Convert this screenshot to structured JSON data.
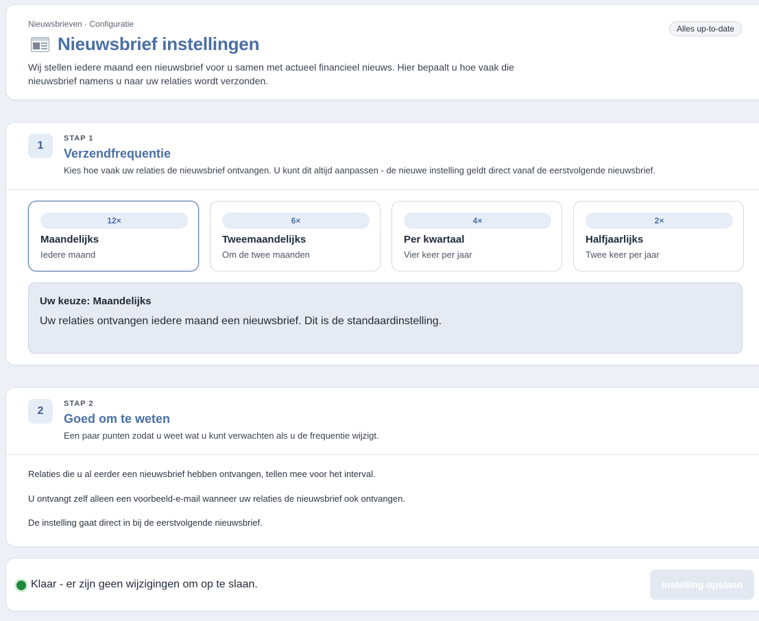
{
  "header": {
    "breadcrumb": "Nieuwsbrieven · Configuratie",
    "status": "Alles up-to-date",
    "icon": "newspaper-icon",
    "title": "Nieuwsbrief instellingen",
    "intro": "Wij stellen iedere maand een nieuwsbrief voor u samen met actueel financieel nieuws. Hier bepaalt u hoe vaak die nieuwsbrief namens u naar uw relaties wordt verzonden."
  },
  "step1": {
    "number": "1",
    "kicker": "STAP 1",
    "title": "Verzendfrequentie",
    "description": "Kies hoe vaak uw relaties de nieuwsbrief ontvangen. U kunt dit altijd aanpassen - de nieuwe instelling geldt direct vanaf de eerstvolgende nieuwsbrief.",
    "options": [
      {
        "count": "12×",
        "name": "Maandelijks",
        "sub": "Iedere maand",
        "selected": true
      },
      {
        "count": "6×",
        "name": "Tweemaandelijks",
        "sub": "Om de twee maanden",
        "selected": false
      },
      {
        "count": "4×",
        "name": "Per kwartaal",
        "sub": "Vier keer per jaar",
        "selected": false
      },
      {
        "count": "2×",
        "name": "Halfjaarlijks",
        "sub": "Twee keer per jaar",
        "selected": false
      }
    ],
    "choice": {
      "title": "Uw keuze: Maandelijks",
      "text": "Uw relaties ontvangen iedere maand een nieuwsbrief. Dit is de standaardinstelling."
    }
  },
  "step2": {
    "number": "2",
    "kicker": "STAP 2",
    "title": "Goed om te weten",
    "description": "Een paar punten zodat u weet wat u kunt verwachten als u de frequentie wijzigt.",
    "tips": [
      "Relaties die u al eerder een nieuwsbrief hebben ontvangen, tellen mee voor het interval.",
      "U ontvangt zelf alleen een voorbeeld-e-mail wanneer uw relaties de nieuwsbrief ook ontvangen.",
      "De instelling gaat direct in bij de eerstvolgende nieuwsbrief."
    ]
  },
  "footer": {
    "status_text": "Klaar - er zijn geen wijzigingen om op te slaan.",
    "save_label": "Instelling opslaan"
  },
  "colors": {
    "accent": "#4a6fa5",
    "ready": "#1f8a3a",
    "background": "#edf1f7"
  }
}
